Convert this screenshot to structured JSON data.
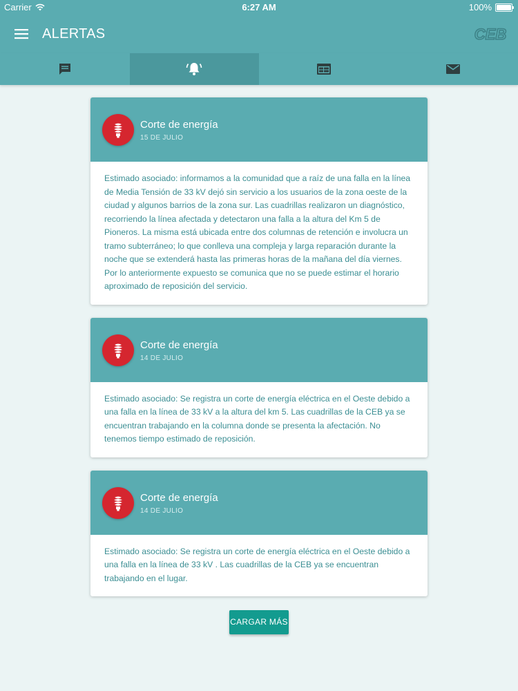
{
  "status": {
    "carrier": "Carrier",
    "time": "6:27 AM",
    "battery": "100%"
  },
  "header": {
    "title": "ALERTAS",
    "logo_text": "CEB"
  },
  "tabs": [
    {
      "name": "messages",
      "icon": "chat-icon"
    },
    {
      "name": "alerts",
      "icon": "bell-icon",
      "active": true
    },
    {
      "name": "calendar",
      "icon": "calendar-icon"
    },
    {
      "name": "mail",
      "icon": "mail-icon"
    }
  ],
  "alerts": [
    {
      "title": "Corte de energía",
      "date": "15 DE JULIO",
      "text": "Estimado asociado: informamos a la comunidad que a raíz de una falla en la línea de Media Tensión de 33 kV dejó sin servicio a los usuarios de la zona oeste de la ciudad y algunos barrios de la zona sur. Las cuadrillas realizaron un diagnóstico, recorriendo la línea afectada y detectaron una falla a la altura del Km 5 de Pioneros. La misma está ubicada entre dos columnas de retención e involucra un tramo subterráneo; lo que conlleva una compleja y larga reparación durante la noche que se extenderá hasta las primeras horas de la mañana del día viernes. Por lo anteriormente expuesto se comunica que no se puede estimar el horario aproximado de reposición del servicio."
    },
    {
      "title": "Corte de energía",
      "date": "14 DE JULIO",
      "text": "Estimado asociado: Se registra un corte de energía eléctrica en el Oeste debido a una falla en la línea de 33 kV a la altura del km 5. Las cuadrillas de la CEB ya se encuentran trabajando en la columna donde se presenta la afectación. No tenemos tiempo estimado de reposición."
    },
    {
      "title": "Corte de energía",
      "date": "14 DE JULIO",
      "text": "Estimado asociado: Se registra un corte de energía eléctrica en el Oeste debido a una falla en la línea de 33 kV . Las cuadrillas de la CEB ya se encuentran trabajando en el lugar."
    }
  ],
  "load_more_label": "CARGAR MÁS",
  "colors": {
    "primary": "#5aacb1",
    "tab_active": "#4b989d",
    "accent": "#d5262f",
    "button": "#139b8f",
    "body_text": "#3b8e93",
    "background": "#ebf4f4"
  }
}
